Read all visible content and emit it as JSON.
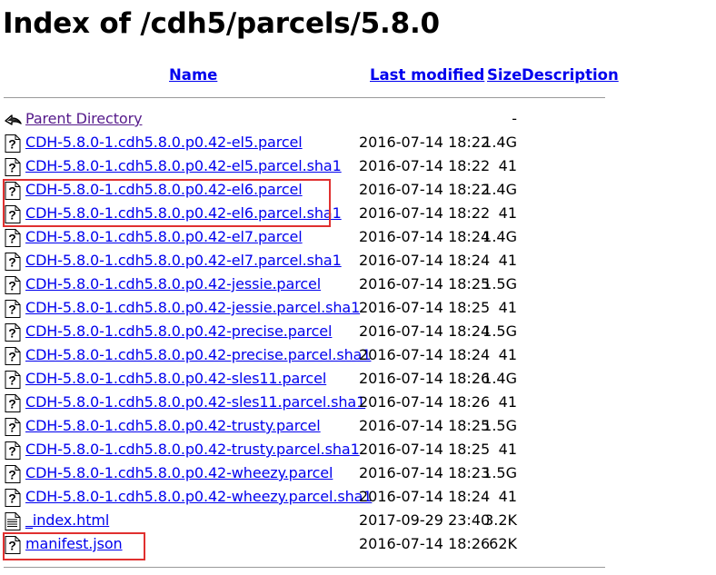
{
  "page": {
    "title": "Index of /cdh5/parcels/5.8.0"
  },
  "table": {
    "headers": {
      "name": "Name",
      "last_modified": "Last modified",
      "size": "Size",
      "description": "Description"
    },
    "rows": [
      {
        "icon": "back-arrow-icon",
        "name": "Parent Directory",
        "date": "",
        "size": "-"
      },
      {
        "icon": "unknown-file-icon",
        "name": "CDH-5.8.0-1.cdh5.8.0.p0.42-el5.parcel",
        "date": "2016-07-14 18:22",
        "size": "1.4G"
      },
      {
        "icon": "unknown-file-icon",
        "name": "CDH-5.8.0-1.cdh5.8.0.p0.42-el5.parcel.sha1",
        "date": "2016-07-14 18:22",
        "size": "41"
      },
      {
        "icon": "unknown-file-icon",
        "name": "CDH-5.8.0-1.cdh5.8.0.p0.42-el6.parcel",
        "date": "2016-07-14 18:22",
        "size": "1.4G"
      },
      {
        "icon": "unknown-file-icon",
        "name": "CDH-5.8.0-1.cdh5.8.0.p0.42-el6.parcel.sha1",
        "date": "2016-07-14 18:22",
        "size": "41"
      },
      {
        "icon": "unknown-file-icon",
        "name": "CDH-5.8.0-1.cdh5.8.0.p0.42-el7.parcel",
        "date": "2016-07-14 18:24",
        "size": "1.4G"
      },
      {
        "icon": "unknown-file-icon",
        "name": "CDH-5.8.0-1.cdh5.8.0.p0.42-el7.parcel.sha1",
        "date": "2016-07-14 18:24",
        "size": "41"
      },
      {
        "icon": "unknown-file-icon",
        "name": "CDH-5.8.0-1.cdh5.8.0.p0.42-jessie.parcel",
        "date": "2016-07-14 18:25",
        "size": "1.5G"
      },
      {
        "icon": "unknown-file-icon",
        "name": "CDH-5.8.0-1.cdh5.8.0.p0.42-jessie.parcel.sha1",
        "date": "2016-07-14 18:25",
        "size": "41"
      },
      {
        "icon": "unknown-file-icon",
        "name": "CDH-5.8.0-1.cdh5.8.0.p0.42-precise.parcel",
        "date": "2016-07-14 18:24",
        "size": "1.5G"
      },
      {
        "icon": "unknown-file-icon",
        "name": "CDH-5.8.0-1.cdh5.8.0.p0.42-precise.parcel.sha1",
        "date": "2016-07-14 18:24",
        "size": "41"
      },
      {
        "icon": "unknown-file-icon",
        "name": "CDH-5.8.0-1.cdh5.8.0.p0.42-sles11.parcel",
        "date": "2016-07-14 18:26",
        "size": "1.4G"
      },
      {
        "icon": "unknown-file-icon",
        "name": "CDH-5.8.0-1.cdh5.8.0.p0.42-sles11.parcel.sha1",
        "date": "2016-07-14 18:26",
        "size": "41"
      },
      {
        "icon": "unknown-file-icon",
        "name": "CDH-5.8.0-1.cdh5.8.0.p0.42-trusty.parcel",
        "date": "2016-07-14 18:25",
        "size": "1.5G"
      },
      {
        "icon": "unknown-file-icon",
        "name": "CDH-5.8.0-1.cdh5.8.0.p0.42-trusty.parcel.sha1",
        "date": "2016-07-14 18:25",
        "size": "41"
      },
      {
        "icon": "unknown-file-icon",
        "name": "CDH-5.8.0-1.cdh5.8.0.p0.42-wheezy.parcel",
        "date": "2016-07-14 18:23",
        "size": "1.5G"
      },
      {
        "icon": "unknown-file-icon",
        "name": "CDH-5.8.0-1.cdh5.8.0.p0.42-wheezy.parcel.sha1",
        "date": "2016-07-14 18:24",
        "size": "41"
      },
      {
        "icon": "text-file-icon",
        "name": "_index.html",
        "date": "2017-09-29 23:40",
        "size": "3.2K"
      },
      {
        "icon": "unknown-file-icon",
        "name": "manifest.json",
        "date": "2016-07-14 18:26",
        "size": "62K"
      }
    ]
  },
  "colors": {
    "link": "#0000ee",
    "visited_link": "#551a8b",
    "highlight_box": "#e0302f",
    "rule": "#9a9a9a"
  }
}
